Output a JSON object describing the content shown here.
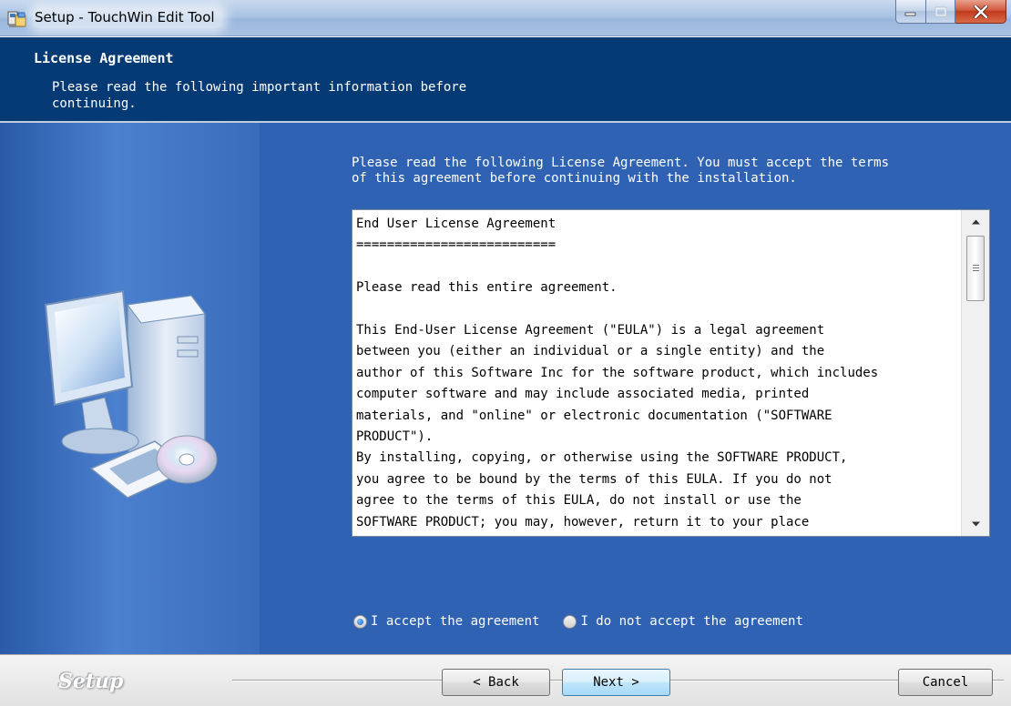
{
  "window": {
    "title": "Setup - TouchWin Edit Tool",
    "icon": "installer-icon",
    "controls": [
      "minimize",
      "maximize",
      "close"
    ]
  },
  "header": {
    "title": "License Agreement",
    "subtitle": "Please read the following important information before\ncontinuing."
  },
  "page": {
    "intro": "Please read the following License Agreement. You must accept the terms\nof this agreement before continuing with the installation.",
    "illustration": "computer-with-cd-icon",
    "license_text": "End User License Agreement\n==========================\n\nPlease read this entire agreement.\n\nThis End-User License Agreement (\"EULA\") is a legal agreement\nbetween you (either an individual or a single entity) and the\nauthor of this Software Inc for the software product, which includes\ncomputer software and may include associated media, printed\nmaterials, and \"online\" or electronic documentation (\"SOFTWARE\nPRODUCT\").\nBy installing, copying, or otherwise using the SOFTWARE PRODUCT,\nyou agree to be bound by the terms of this EULA. If you do not\nagree to the terms of this EULA, do not install or use the\nSOFTWARE PRODUCT; you may, however, return it to your place",
    "radio_accept": "I accept the agreement",
    "radio_decline": "I do not accept the agreement",
    "selected_option": "accept"
  },
  "footer": {
    "brand": "Setup",
    "back_label": "< Back",
    "next_label": "Next >",
    "cancel_label": "Cancel"
  },
  "colors": {
    "header_bg": "#063a75",
    "body_bg": "#2f62b2",
    "text_on_blue": "#ffffff"
  }
}
